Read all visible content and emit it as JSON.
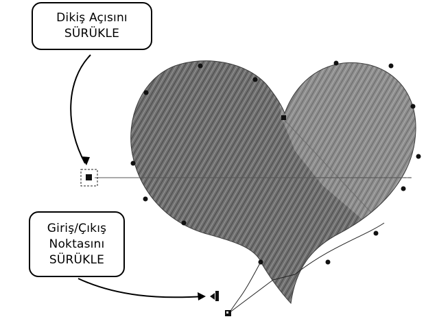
{
  "callouts": {
    "stitch_angle": {
      "line1": "Dikiş Açısını",
      "line2": "SÜRÜKLE"
    },
    "entry_exit": {
      "line1": "Giriş/Çıkış",
      "line2": "Noktasını",
      "line3": "SÜRÜKLE"
    }
  },
  "colors": {
    "stitch_dark": "#6e6e6e",
    "stitch_light": "#8c8c8c",
    "outline": "#000000",
    "guide_line": "#444444"
  },
  "icons": {
    "angle_handle": "square-handle-icon",
    "entry_marker": "entry-arrow-icon",
    "exit_marker": "exit-square-icon",
    "nodes": "reshape-node-icon"
  }
}
